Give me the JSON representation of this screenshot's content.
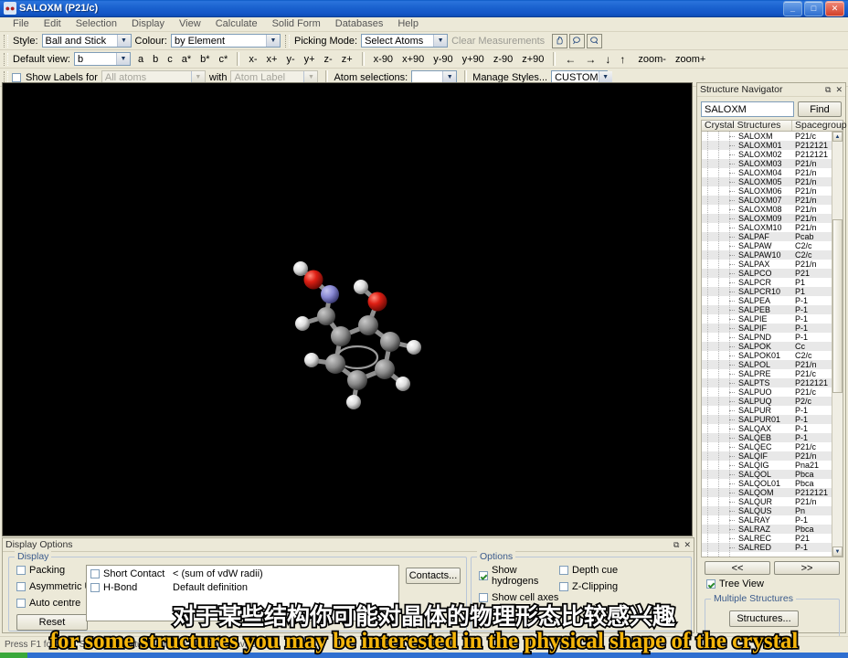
{
  "window": {
    "title": "SALOXM (P21/c)",
    "icon": "app-molecule-icon",
    "minimize": "_",
    "restore": "□",
    "close": "✕"
  },
  "menubar": {
    "items": [
      "File",
      "Edit",
      "Selection",
      "Display",
      "View",
      "Calculate",
      "Solid Form",
      "Databases",
      "Help"
    ]
  },
  "toolbar_row1": {
    "style_label": "Style:",
    "style_value": "Ball and Stick",
    "colour_label": "Colour:",
    "colour_value": "by Element",
    "picking_label": "Picking Mode:",
    "picking_value": "Select Atoms",
    "clear_measurements": "Clear Measurements",
    "icons": [
      "hand-icon",
      "magnifier-icon",
      "rotate-icon"
    ]
  },
  "toolbar_row2": {
    "default_view_label": "Default view:",
    "default_view_value": "b",
    "axes": [
      "a",
      "b",
      "c",
      "a*",
      "b*",
      "c*"
    ],
    "shifts": [
      "x-",
      "x+",
      "y-",
      "y+",
      "z-",
      "z+"
    ],
    "rotations": [
      "x-90",
      "x+90",
      "y-90",
      "y+90",
      "z-90",
      "z+90"
    ],
    "arrows": [
      "←",
      "→",
      "↓",
      "↑"
    ],
    "zoom_out": "zoom-",
    "zoom_in": "zoom+"
  },
  "toolbar_row3": {
    "show_labels_label": "Show Labels for",
    "show_labels_checked": false,
    "atoms_value": "All atoms",
    "with_label": "with",
    "atom_label_value": "Atom Label",
    "atom_selections_label": "Atom selections:",
    "atom_selections_value": "",
    "manage_styles": "Manage Styles...",
    "custom_style_value": "CUSTOM"
  },
  "display_options": {
    "title": "Display Options",
    "restore_icon": "restore-icon",
    "close_icon": "close-icon",
    "display_group": "Display",
    "checkboxes": [
      {
        "label": "Packing",
        "checked": false
      },
      {
        "label": "Asymmetric Unit",
        "checked": false
      },
      {
        "label": "Auto centre",
        "checked": false
      }
    ],
    "reset_button": "Reset",
    "contacts_list": [
      {
        "label": "Short Contact",
        "detail": "< (sum of vdW radii)",
        "checked": false
      },
      {
        "label": "H-Bond",
        "detail": "Default definition",
        "checked": false
      }
    ],
    "contacts_button": "Contacts...",
    "options_group": "Options",
    "options_checkboxes": [
      {
        "label": "Show hydrogens",
        "checked": true
      },
      {
        "label": "Depth cue",
        "checked": false
      },
      {
        "label": "Show cell axes",
        "checked": false
      },
      {
        "label": "Z-Clipping",
        "checked": false
      }
    ]
  },
  "navigator": {
    "title": "Structure Navigator",
    "restore_icon": "restore-icon",
    "close_icon": "close-icon",
    "search_value": "SALOXM",
    "find_button": "Find",
    "columns": [
      "Crystal Structures",
      "Spacegroup"
    ],
    "prev_button": "<<",
    "next_button": ">>",
    "tree_view_label": "Tree View",
    "tree_view_checked": true,
    "multiple_structures_label": "Multiple Structures",
    "structures_button": "Structures...",
    "rows": [
      {
        "name": "SALOXM",
        "sg": "P21/c"
      },
      {
        "name": "SALOXM01",
        "sg": "P212121"
      },
      {
        "name": "SALOXM02",
        "sg": "P212121"
      },
      {
        "name": "SALOXM03",
        "sg": "P21/n"
      },
      {
        "name": "SALOXM04",
        "sg": "P21/n"
      },
      {
        "name": "SALOXM05",
        "sg": "P21/n"
      },
      {
        "name": "SALOXM06",
        "sg": "P21/n"
      },
      {
        "name": "SALOXM07",
        "sg": "P21/n"
      },
      {
        "name": "SALOXM08",
        "sg": "P21/n"
      },
      {
        "name": "SALOXM09",
        "sg": "P21/n"
      },
      {
        "name": "SALOXM10",
        "sg": "P21/n"
      },
      {
        "name": "SALPAF",
        "sg": "Pcab"
      },
      {
        "name": "SALPAW",
        "sg": "C2/c"
      },
      {
        "name": "SALPAW10",
        "sg": "C2/c"
      },
      {
        "name": "SALPAX",
        "sg": "P21/n"
      },
      {
        "name": "SALPCO",
        "sg": "P21"
      },
      {
        "name": "SALPCR",
        "sg": "P1"
      },
      {
        "name": "SALPCR10",
        "sg": "P1"
      },
      {
        "name": "SALPEA",
        "sg": "P-1"
      },
      {
        "name": "SALPEB",
        "sg": "P-1"
      },
      {
        "name": "SALPIE",
        "sg": "P-1"
      },
      {
        "name": "SALPIF",
        "sg": "P-1"
      },
      {
        "name": "SALPND",
        "sg": "P-1"
      },
      {
        "name": "SALPOK",
        "sg": "Cc"
      },
      {
        "name": "SALPOK01",
        "sg": "C2/c"
      },
      {
        "name": "SALPOL",
        "sg": "P21/n"
      },
      {
        "name": "SALPRE",
        "sg": "P21/c"
      },
      {
        "name": "SALPTS",
        "sg": "P212121"
      },
      {
        "name": "SALPUO",
        "sg": "P21/c"
      },
      {
        "name": "SALPUQ",
        "sg": "P2/c"
      },
      {
        "name": "SALPUR",
        "sg": "P-1"
      },
      {
        "name": "SALPUR01",
        "sg": "P-1"
      },
      {
        "name": "SALQAX",
        "sg": "P-1"
      },
      {
        "name": "SALQEB",
        "sg": "P-1"
      },
      {
        "name": "SALQEC",
        "sg": "P21/c"
      },
      {
        "name": "SALQIF",
        "sg": "P21/n"
      },
      {
        "name": "SALQIG",
        "sg": "Pna21"
      },
      {
        "name": "SALQOL",
        "sg": "Pbca"
      },
      {
        "name": "SALQOL01",
        "sg": "Pbca"
      },
      {
        "name": "SALQOM",
        "sg": "P212121"
      },
      {
        "name": "SALQUR",
        "sg": "P21/n"
      },
      {
        "name": "SALQUS",
        "sg": "Pn"
      },
      {
        "name": "SALRAY",
        "sg": "P-1"
      },
      {
        "name": "SALRAZ",
        "sg": "Pbca"
      },
      {
        "name": "SALREC",
        "sg": "P21"
      },
      {
        "name": "SALRED",
        "sg": "P-1"
      }
    ]
  },
  "statusbar": {
    "text": "Press F1 for help. Select a structure from the Structure Navigator."
  },
  "subtitles": {
    "chinese": "对于某些结构你可能对晶体的物理形态比较感兴趣",
    "english": "for some structures you may be interested in the physical shape of the crystal"
  },
  "molecule": {
    "description": "salicylaldoxime ball-and-stick model",
    "colors": {
      "carbon": "#8c8c8c",
      "hydrogen": "#e8e8e8",
      "oxygen": "#d81a1a",
      "nitrogen": "#8a8ad0",
      "background": "#000000"
    }
  }
}
